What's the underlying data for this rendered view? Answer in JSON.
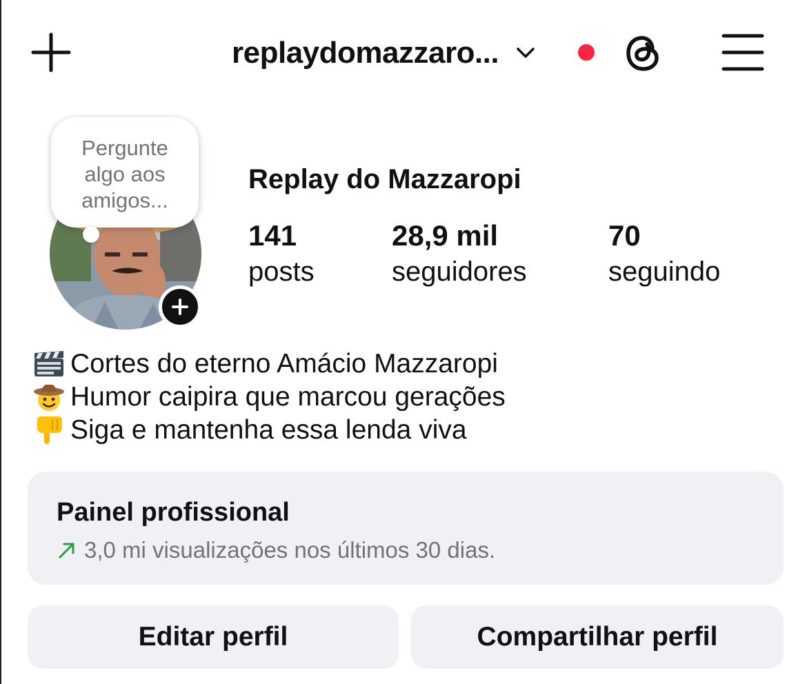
{
  "header": {
    "username": "replaydomazzaro...",
    "icons": {
      "left": "plus-icon",
      "dropdown": "chevron-down-icon",
      "notification": "red-dot",
      "threads": "threads-icon",
      "menu": "hamburger-menu-icon"
    },
    "notification_color": "#ff2442"
  },
  "note": {
    "text_lines": [
      "Pergunte",
      "algo aos",
      "amigos..."
    ]
  },
  "profile": {
    "display_name": "Replay do Mazzaropi",
    "stats": [
      {
        "value": "141",
        "label": "posts"
      },
      {
        "value": "28,9 mil",
        "label": "seguidores"
      },
      {
        "value": "70",
        "label": "seguindo"
      }
    ]
  },
  "bio": [
    {
      "emoji": "clapper-board-icon",
      "text": "Cortes do eterno Amácio Mazzaropi"
    },
    {
      "emoji": "cowboy-face-icon",
      "text": "Humor caipira que marcou gerações"
    },
    {
      "emoji": "pointing-down-icon",
      "text": "Siga e mantenha essa lenda viva"
    }
  ],
  "professional_panel": {
    "title": "Painel profissional",
    "subtitle": "3,0 mi visualizações nos últimos 30 dias.",
    "trend_color": "#2a9d4a"
  },
  "buttons": {
    "edit": "Editar perfil",
    "share": "Compartilhar perfil"
  }
}
